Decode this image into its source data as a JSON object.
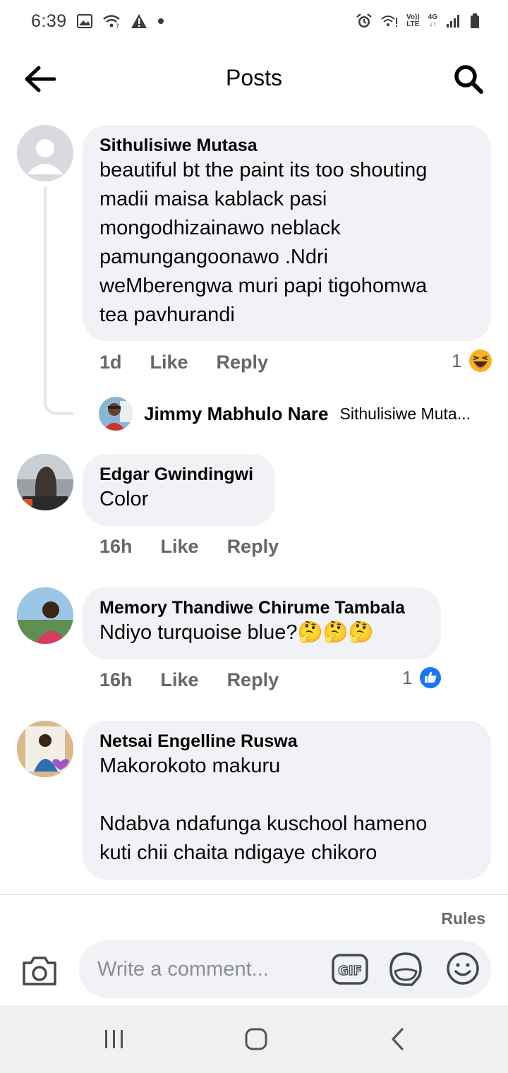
{
  "status_bar": {
    "time": "6:39",
    "lte_top": "Vo))",
    "lte_bottom": "LTE",
    "net": "4G"
  },
  "header": {
    "title": "Posts"
  },
  "comments": [
    {
      "author": "Sithulisiwe Mutasa",
      "text": "beautiful bt the paint its too shouting\nmadii maisa kablack pasi\nmongodhizainawo neblack\npamungangoonawo .Ndri\nweMberengwa muri papi tigohomwa\ntea pavhurandi",
      "time": "1d",
      "like": "Like",
      "reply": "Reply",
      "reaction_count": "1",
      "reaction": "haha-emoji"
    },
    {
      "author": "Edgar Gwindingwi",
      "text": "Color",
      "time": "16h",
      "like": "Like",
      "reply": "Reply"
    },
    {
      "author": "Memory Thandiwe Chirume Tambala",
      "text": "Ndiyo turquoise blue?",
      "emoji": "🤔🤔🤔",
      "time": "16h",
      "like": "Like",
      "reply": "Reply",
      "reaction_count": "1",
      "reaction": "like-emoji"
    },
    {
      "author": "Netsai Engelline Ruswa",
      "text": "Makorokoto makuru\n\nNdabva ndafunga kuschool hameno\nkuti chii chaita ndigaye chikoro"
    }
  ],
  "reply_preview": {
    "author": "Jimmy Mabhulo Nare",
    "snippet": "Sithulisiwe Muta..."
  },
  "composer": {
    "rules": "Rules",
    "placeholder": "Write a comment...",
    "gif": "GIF"
  },
  "colors": {
    "bubble": "#f0f2f5",
    "muted": "#65676b",
    "like_blue": "#1877f2",
    "haha_yellow": "#f7b125"
  }
}
